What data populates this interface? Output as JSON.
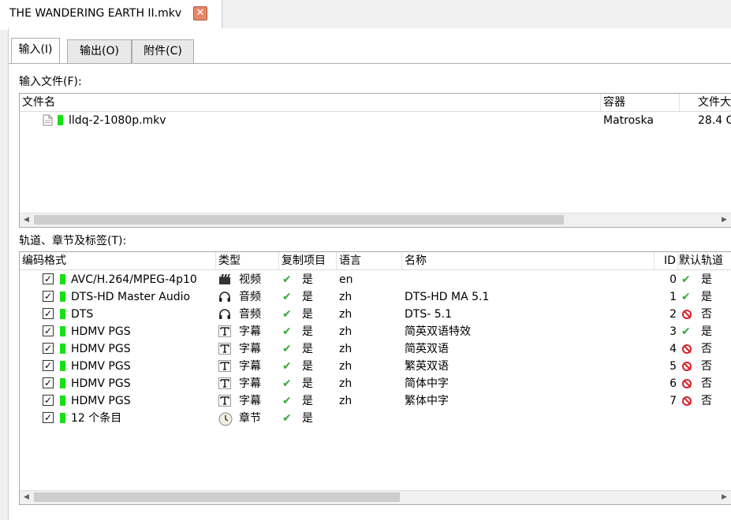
{
  "document_tab": {
    "title": "THE WANDERING EARTH II.mkv",
    "close_glyph": "✕"
  },
  "sub_tabs": [
    {
      "label": "输入(I)",
      "active": true
    },
    {
      "label": "输出(O)",
      "active": false
    },
    {
      "label": "附件(C)",
      "active": false
    }
  ],
  "input_files": {
    "label": "输入文件(F):",
    "columns": [
      "文件名",
      "容器",
      "文件大"
    ],
    "rows": [
      {
        "name": "lldq-2-1080p.mkv",
        "container": "Matroska",
        "size": "28.4 G"
      }
    ]
  },
  "tracks": {
    "label": "轨道、章节及标签(T):",
    "columns": [
      "编码格式",
      "类型",
      "复制项目",
      "语言",
      "名称",
      "ID",
      "默认轨道"
    ],
    "rows": [
      {
        "codec": "AVC/H.264/MPEG-4p10",
        "type_icon": "film-icon",
        "type": "视频",
        "copy": "是",
        "lang": "en",
        "name": "",
        "id": "0",
        "default_yes": true,
        "default": "是"
      },
      {
        "codec": "DTS-HD Master Audio",
        "type_icon": "headphones-icon",
        "type": "音频",
        "copy": "是",
        "lang": "zh",
        "name": "DTS-HD MA 5.1",
        "id": "1",
        "default_yes": true,
        "default": "是"
      },
      {
        "codec": "DTS",
        "type_icon": "headphones-icon",
        "type": "音频",
        "copy": "是",
        "lang": "zh",
        "name": "DTS- 5.1",
        "id": "2",
        "default_yes": false,
        "default": "否"
      },
      {
        "codec": "HDMV PGS",
        "type_icon": "text-icon",
        "type": "字幕",
        "copy": "是",
        "lang": "zh",
        "name": "简英双语特效",
        "id": "3",
        "default_yes": true,
        "default": "是"
      },
      {
        "codec": "HDMV PGS",
        "type_icon": "text-icon",
        "type": "字幕",
        "copy": "是",
        "lang": "zh",
        "name": "简英双语",
        "id": "4",
        "default_yes": false,
        "default": "否"
      },
      {
        "codec": "HDMV PGS",
        "type_icon": "text-icon",
        "type": "字幕",
        "copy": "是",
        "lang": "zh",
        "name": "繁英双语",
        "id": "5",
        "default_yes": false,
        "default": "否"
      },
      {
        "codec": "HDMV PGS",
        "type_icon": "text-icon",
        "type": "字幕",
        "copy": "是",
        "lang": "zh",
        "name": "简体中字",
        "id": "6",
        "default_yes": false,
        "default": "否"
      },
      {
        "codec": "HDMV PGS",
        "type_icon": "text-icon",
        "type": "字幕",
        "copy": "是",
        "lang": "zh",
        "name": "繁体中字",
        "id": "7",
        "default_yes": false,
        "default": "否"
      },
      {
        "codec": "12 个条目",
        "type_icon": "clock-icon",
        "type": "章节",
        "copy": "是",
        "lang": "",
        "name": "",
        "id": "",
        "default_yes": null,
        "default": ""
      }
    ]
  },
  "colors": {
    "enabled_mark": "#16e016",
    "check": "#3aa83a",
    "no": "#d8202a",
    "close_bg": "#e8876a"
  }
}
